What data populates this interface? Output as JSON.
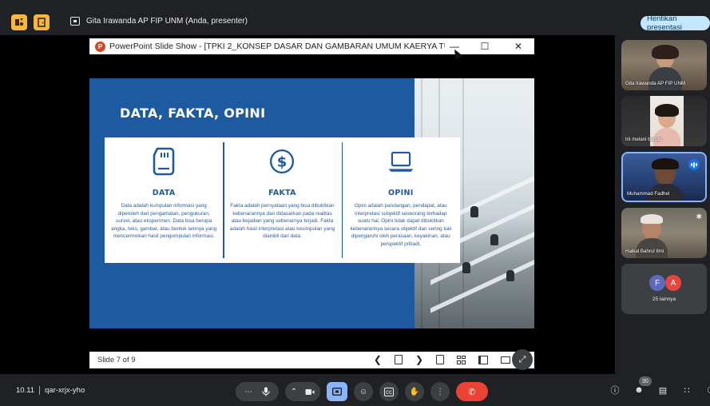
{
  "topbar": {
    "presenter_text": "Gita Irawanda AP FIP UNM (Anda, presenter)",
    "stop_presenting_label": "Hentikan presentasi"
  },
  "ppt": {
    "window_title": "PowerPoint Slide Show - [TPKI 2_KONSEP DASAR DAN GAMBARAN UMUM KAERYA TU...",
    "minimize": "—",
    "maximize": "☐",
    "close": "✕",
    "slide_indicator": "Slide 7 of 9",
    "slide": {
      "heading": "DATA, FAKTA, OPINI",
      "columns": [
        {
          "title": "DATA",
          "icon": "sd-card-icon",
          "body": "Data adalah kumpulan informasi yang diperoleh dari pengamatan, pengukuran, survei, atau eksperimen. Data bisa berupa angka, teks, gambar, atau bentuk lainnya yang mencerminkan hasil pengumpulan informasi."
        },
        {
          "title": "FAKTA",
          "icon": "dollar-circle-icon",
          "body": "Fakta adalah pernyataan yang bisa dibuktikan kebenarannya dan didasarkan pada realitas atau kejadian yang sebenarnya terjadi. Fakta adalah hasil interpretasi atau kesimpulan yang diambil dari data."
        },
        {
          "title": "OPINI",
          "icon": "laptop-icon",
          "body": "Opini adalah pandangan, pendapat, atau interpretasi subjektif seseorang terhadap suatu hal. Opini tidak dapat dibuktikan kebenarannya secara objektif dan sering kali dipengaruhi oleh perasaan, keyakinan, atau perspektif pribadi."
        }
      ]
    }
  },
  "participants": [
    {
      "name": "Gita Irawanda AP FIP UNM"
    },
    {
      "name": "trii melani berutu"
    },
    {
      "name": "Muhammad Fadhel"
    },
    {
      "name": "Haikal Bahrul Ilmi"
    }
  ],
  "more_participants": {
    "avatars": [
      {
        "letter": "F",
        "color": "#5c6bc0"
      },
      {
        "letter": "A",
        "color": "#e8453c"
      }
    ],
    "label": "25 lainnya"
  },
  "bottombar": {
    "time": "10.11",
    "meeting_code": "qar-xrjx-yho",
    "participant_count": "30"
  }
}
